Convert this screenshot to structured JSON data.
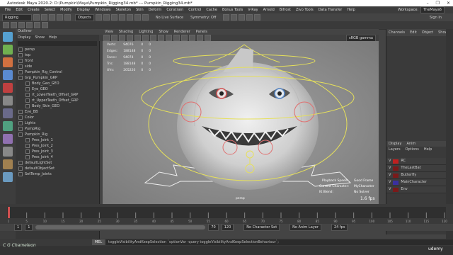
{
  "titlebar": {
    "text": "Autodesk Maya 2020.2: D:\\Pumpkin\\Maya\\Pumpkin_Rigging34.mb*  ---  Pumpkin_Rigging34.mb*",
    "controls": [
      "–",
      "❐",
      "✕"
    ]
  },
  "menubar": {
    "items": [
      "File",
      "Edit",
      "Create",
      "Select",
      "Modify",
      "Display",
      "Windows",
      "Skeleton",
      "Skin",
      "Deform",
      "Constrain",
      "Control",
      "Cache",
      "Bonus Tools",
      "V-Ray",
      "Arnold",
      "Bifrost",
      "Zivo Tools",
      "Data Transfer",
      "Help"
    ],
    "workspace_label": "Workspace:",
    "workspace_value": "TheMaya6"
  },
  "status": {
    "mode": "Rigging",
    "objects": "Objects",
    "live_surface": "No Live Surface",
    "symmetry": "Symmetry: Off",
    "sign_in": "Sign In"
  },
  "outliner": {
    "title": "Outliner",
    "menu": [
      "Display",
      "Show",
      "Help"
    ],
    "items": [
      "persp",
      "top",
      "front",
      "side",
      "Pumpkin_Rig_Control",
      "Grp_Pumpkin_GRP",
      "Body_Geo_GEO",
      "Eye_GEO",
      "rt_LowerTeeth_Offset_GRP",
      "rt_UpperTeeth_Offset_GRP",
      "Body_Skin_GEO",
      "Eye_BB",
      "Color",
      "Lights",
      "PumpRig",
      "Pumpkin_Rig",
      "Pres_Joint_1",
      "Pres_Joint_2",
      "Pres_Joint_3",
      "Pres_Joint_4",
      "defaultLightSet",
      "defaultObjectSet",
      "SetTemp_Joints"
    ]
  },
  "viewport": {
    "menu": [
      "View",
      "Shading",
      "Lighting",
      "Show",
      "Renderer",
      "Panels"
    ],
    "hud": [
      [
        "Verts:",
        "94076",
        "0",
        "0"
      ],
      [
        "Edges:",
        "188148",
        "0",
        "0"
      ],
      [
        "Faces:",
        "94074",
        "0",
        "0"
      ],
      [
        "Tris:",
        "188148",
        "0",
        "0"
      ],
      [
        "UVs:",
        "205220",
        "0",
        "0"
      ]
    ],
    "camera": "persp",
    "playback_speed_label": "Playback Speed:",
    "playback_speed_value": "Good Frame",
    "current_character_label": "Current Character:",
    "current_character_value": "MyCharacter",
    "ik_blend_label": "IK Blend:",
    "ik_blend_value": "No Solver",
    "fps": "1.6 fps",
    "gamma": "sRGB gamma"
  },
  "channelbox": {
    "tabs": [
      "Channels",
      "Edit",
      "Object",
      "Show"
    ],
    "display_tabs": [
      "Display",
      "Anim"
    ],
    "layer_menu": [
      "Layers",
      "Options",
      "Help"
    ],
    "layers": [
      {
        "name": "RC",
        "color": "#c02020"
      },
      {
        "name": "TheLastBat",
        "color": "#7a1a1a"
      },
      {
        "name": "Butterfly",
        "color": "#7a1a1a"
      },
      {
        "name": "MainCharacter",
        "color": "#3a30a0"
      },
      {
        "name": "Env",
        "color": "#7a1a1a"
      }
    ]
  },
  "timeline": {
    "ticks": [
      "1",
      "5",
      "10",
      "15",
      "20",
      "25",
      "30",
      "35",
      "40",
      "45",
      "50",
      "55",
      "60",
      "65",
      "70",
      "75",
      "80",
      "85",
      "90",
      "95",
      "100",
      "105",
      "110",
      "115",
      "120"
    ],
    "current_frame": "1"
  },
  "rangebar": {
    "start": "1",
    "inner_start": "1",
    "inner_end": "70",
    "end": "120",
    "character": "No Character Set",
    "anim_layer": "No Anim Layer",
    "fps": "24 fps"
  },
  "cmdline": {
    "label": "MEL",
    "text": "toggleVisibilityAndKeepSelection `optionVar -query toggleVisibilityAndKeepSelectionBehaviour`;"
  },
  "watermark": "C G Chameleon",
  "udemy": "udemy"
}
